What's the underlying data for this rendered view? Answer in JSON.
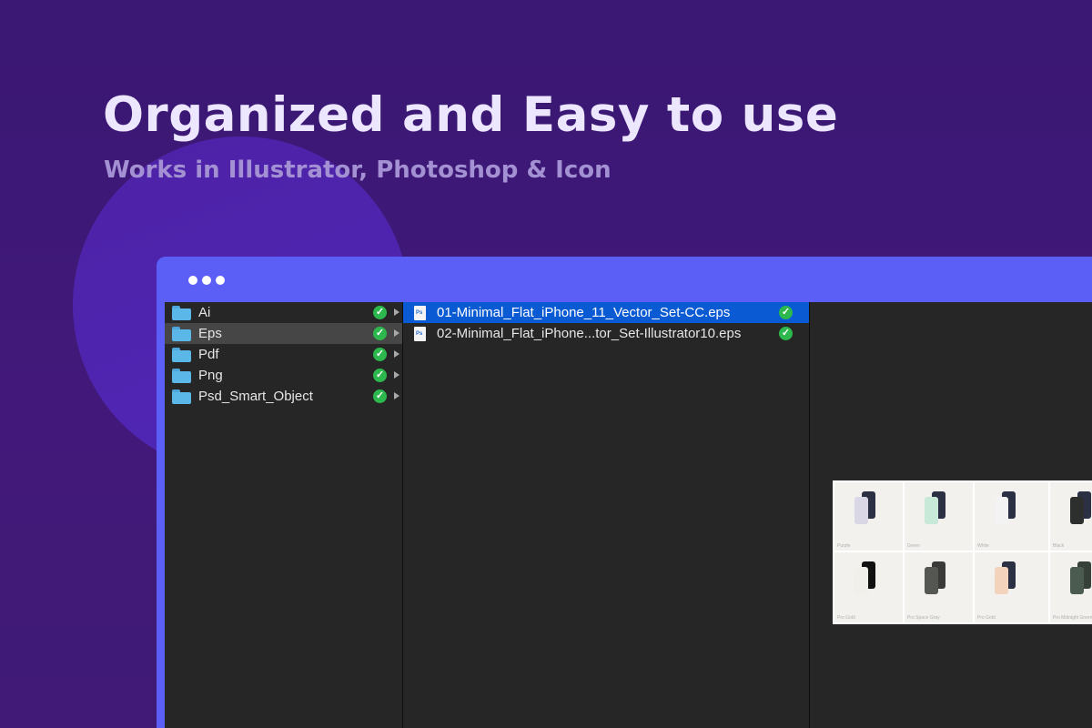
{
  "headline": "Organized and Easy to use",
  "subhead": "Works in Illustrator, Photoshop & Icon",
  "colors": {
    "background": "#3f1a78",
    "window_frame": "#5b5ff5",
    "finder_bg": "#262627",
    "selection": "#0a5bd3",
    "folder": "#5ab7e8",
    "check": "#2db84d"
  },
  "folders": [
    {
      "label": "Ai",
      "status_icon": "check-icon",
      "highlighted": false
    },
    {
      "label": "Eps",
      "status_icon": "check-icon",
      "highlighted": true
    },
    {
      "label": "Pdf",
      "status_icon": "check-icon",
      "highlighted": false
    },
    {
      "label": "Png",
      "status_icon": "check-icon",
      "highlighted": false
    },
    {
      "label": "Psd_Smart_Object",
      "status_icon": "check-icon",
      "highlighted": false
    }
  ],
  "files": [
    {
      "label": "01-Minimal_Flat_iPhone_11_Vector_Set-CC.eps",
      "selected": true
    },
    {
      "label": "02-Minimal_Flat_iPhone...tor_Set-Illustrator10.eps",
      "selected": false
    }
  ],
  "preview_tiles": [
    {
      "caption": "Purple",
      "front": "#d9d6e6",
      "back": "#2c3045"
    },
    {
      "caption": "Green",
      "front": "#c8e9d8",
      "back": "#2c3045"
    },
    {
      "caption": "White",
      "front": "#f3f3f3",
      "back": "#2c3045"
    },
    {
      "caption": "Black",
      "front": "#2d2f2f",
      "back": "#2c3045"
    },
    {
      "caption": "Pro Gold",
      "front": "#f0efea",
      "back": "#111111"
    },
    {
      "caption": "Pro Space Gray",
      "front": "#555752",
      "back": "#3a3b38"
    },
    {
      "caption": "Pro Gold",
      "front": "#f4d3bd",
      "back": "#2c3045"
    },
    {
      "caption": "Pro Midnight Green",
      "front": "#4c5b4f",
      "back": "#37413a"
    }
  ]
}
